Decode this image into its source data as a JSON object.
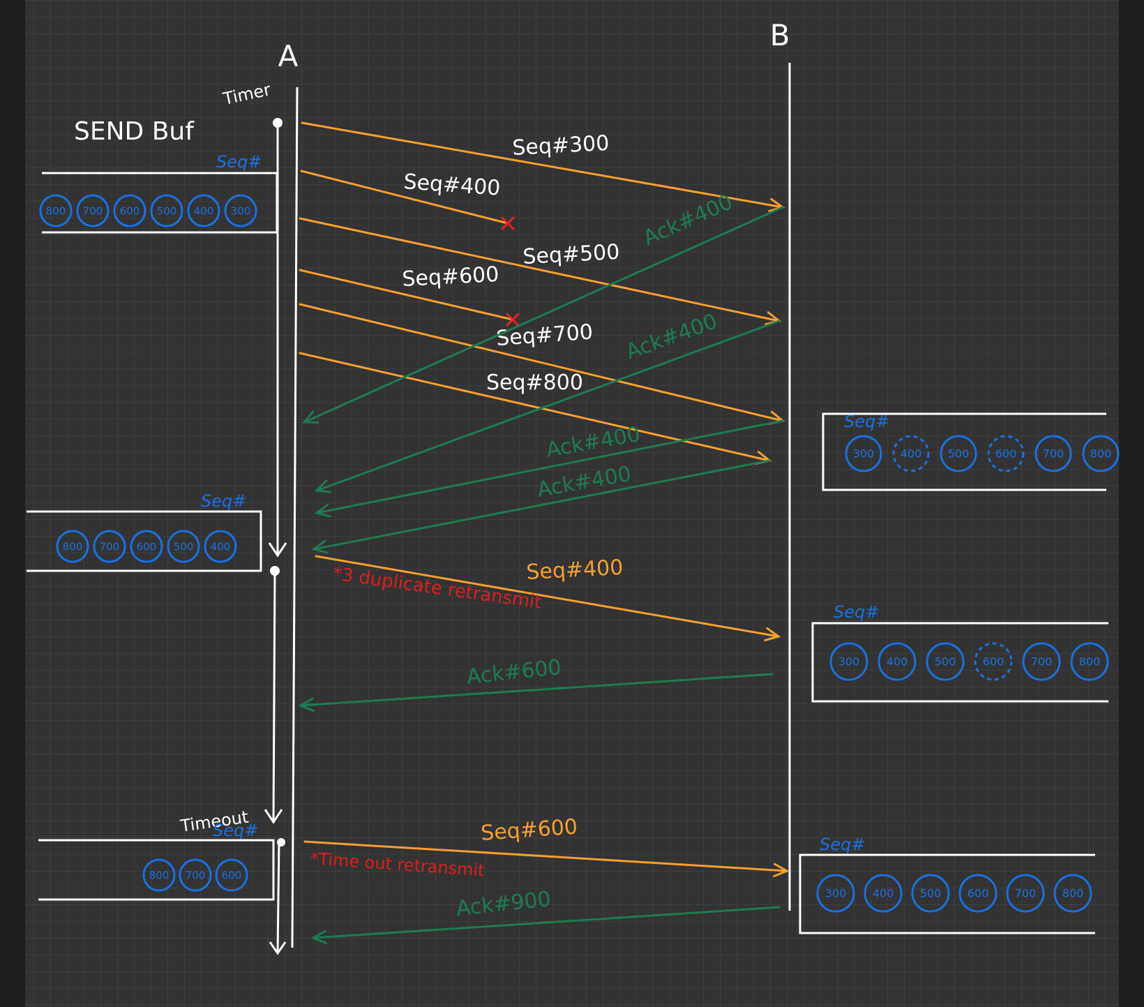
{
  "colors": {
    "background": "#333333",
    "grid": "#4a4a4a",
    "frame": "#1e1e1e",
    "white": "#ffffff",
    "seq_arrow": "#f5a030",
    "ack_arrow": "#1e7a50",
    "loss_mark": "#e02424",
    "buffer_blue": "#1a6fe0",
    "note_red": "#d81e1e"
  },
  "labels": {
    "host_a": "A",
    "host_b": "B",
    "send_buf": "SEND Buf",
    "timer": "Timer",
    "timeout": "Timeout",
    "seq_header": "Seq#",
    "dup_note": "*3 duplicate retransmit",
    "timeout_note": "*Time out retransmit"
  },
  "segments": [
    {
      "label": "Seq#300",
      "lost": false
    },
    {
      "label": "Seq#400",
      "lost": true
    },
    {
      "label": "Seq#500",
      "lost": false
    },
    {
      "label": "Seq#600",
      "lost": true
    },
    {
      "label": "Seq#700",
      "lost": false
    },
    {
      "label": "Seq#800",
      "lost": false
    },
    {
      "label": "Seq#400",
      "lost": false
    },
    {
      "label": "Seq#600",
      "lost": false
    }
  ],
  "acks": [
    {
      "label": "Ack#400"
    },
    {
      "label": "Ack#400"
    },
    {
      "label": "Ack#400"
    },
    {
      "label": "Ack#400"
    },
    {
      "label": "Ack#600"
    },
    {
      "label": "Ack#900"
    }
  ],
  "send_buffers": [
    {
      "items": [
        {
          "label": "800"
        },
        {
          "label": "700"
        },
        {
          "label": "600"
        },
        {
          "label": "500"
        },
        {
          "label": "400"
        },
        {
          "label": "300"
        }
      ]
    },
    {
      "items": [
        {
          "label": "800"
        },
        {
          "label": "700"
        },
        {
          "label": "600"
        },
        {
          "label": "500"
        },
        {
          "label": "400"
        }
      ]
    },
    {
      "items": [
        {
          "label": "800"
        },
        {
          "label": "700"
        },
        {
          "label": "600"
        }
      ]
    }
  ],
  "recv_buffers": [
    {
      "items": [
        {
          "label": "300",
          "missing": false
        },
        {
          "label": "400",
          "missing": true
        },
        {
          "label": "500",
          "missing": false
        },
        {
          "label": "600",
          "missing": true
        },
        {
          "label": "700",
          "missing": false
        },
        {
          "label": "800",
          "missing": false
        }
      ]
    },
    {
      "items": [
        {
          "label": "300",
          "missing": false
        },
        {
          "label": "400",
          "missing": false
        },
        {
          "label": "500",
          "missing": false
        },
        {
          "label": "600",
          "missing": true
        },
        {
          "label": "700",
          "missing": false
        },
        {
          "label": "800",
          "missing": false
        }
      ]
    },
    {
      "items": [
        {
          "label": "300",
          "missing": false
        },
        {
          "label": "400",
          "missing": false
        },
        {
          "label": "500",
          "missing": false
        },
        {
          "label": "600",
          "missing": false
        },
        {
          "label": "700",
          "missing": false
        },
        {
          "label": "800",
          "missing": false
        }
      ]
    }
  ]
}
